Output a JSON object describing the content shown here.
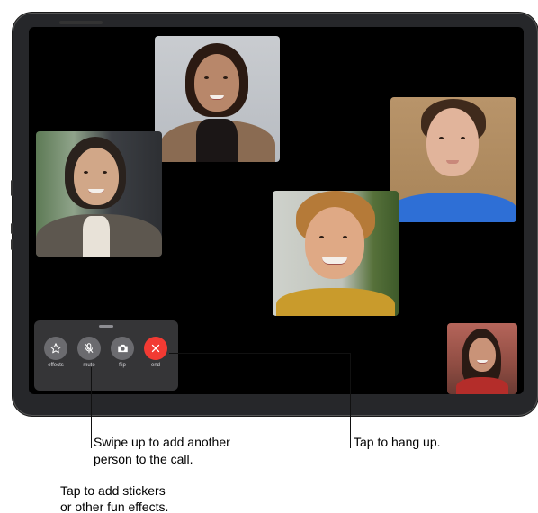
{
  "colors": {
    "frame": "#26272a",
    "screen": "#000000",
    "panel": "#3a3a3c",
    "control_button": "#6b6b6f",
    "end_button": "#f23a33"
  },
  "controls": {
    "effects_label": "effects",
    "mute_label": "mute",
    "flip_label": "flip",
    "end_label": "end",
    "icons": [
      "star-icon",
      "microphone-slash-icon",
      "camera-icon",
      "close-icon"
    ]
  },
  "callouts": {
    "hang_up": "Tap to hang up.",
    "add_person_line1": "Swipe up to add another",
    "add_person_line2": "person to the call.",
    "effects_line1": "Tap to add stickers",
    "effects_line2": "or other fun effects."
  }
}
